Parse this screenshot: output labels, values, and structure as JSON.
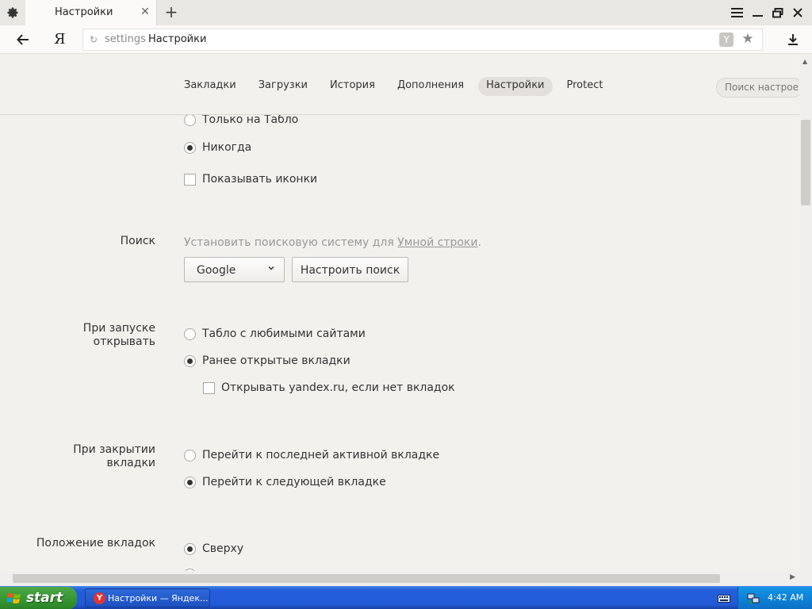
{
  "browser": {
    "tab_title": "Настройки",
    "logo": "Я",
    "address_prefix": "settings",
    "address_title": "Настройки"
  },
  "settings": {
    "nav": [
      {
        "label": "Закладки",
        "active": false
      },
      {
        "label": "Загрузки",
        "active": false
      },
      {
        "label": "История",
        "active": false
      },
      {
        "label": "Дополнения",
        "active": false
      },
      {
        "label": "Настройки",
        "active": true
      },
      {
        "label": "Protect",
        "active": false
      }
    ],
    "search_placeholder": "Поиск настроек",
    "tabs_display": {
      "option_tablo_only": "Только на Табло",
      "option_never": "Никогда",
      "show_icons": "Показывать иконки"
    },
    "search": {
      "label": "Поиск",
      "hint_prefix": "Установить поисковую систему для ",
      "hint_link": "Умной строки",
      "hint_suffix": ".",
      "engine": "Google",
      "configure_button": "Настроить поиск"
    },
    "startup": {
      "label_line1": "При запуске",
      "label_line2": "открывать",
      "option_tablo": "Табло с любимыми сайтами",
      "option_previous": "Ранее открытые вкладки",
      "open_yandex": "Открывать yandex.ru, если нет вкладок"
    },
    "on_close": {
      "label_line1": "При закрытии",
      "label_line2": "вкладки",
      "option_last_active": "Перейти к последней активной вкладке",
      "option_next": "Перейти к следующей вкладке"
    },
    "tab_position": {
      "label": "Положение вкладок",
      "option_top": "Сверху"
    }
  },
  "taskbar": {
    "start": "start",
    "task_item": "Настройки — Яндек...",
    "clock": "4:42 AM"
  }
}
